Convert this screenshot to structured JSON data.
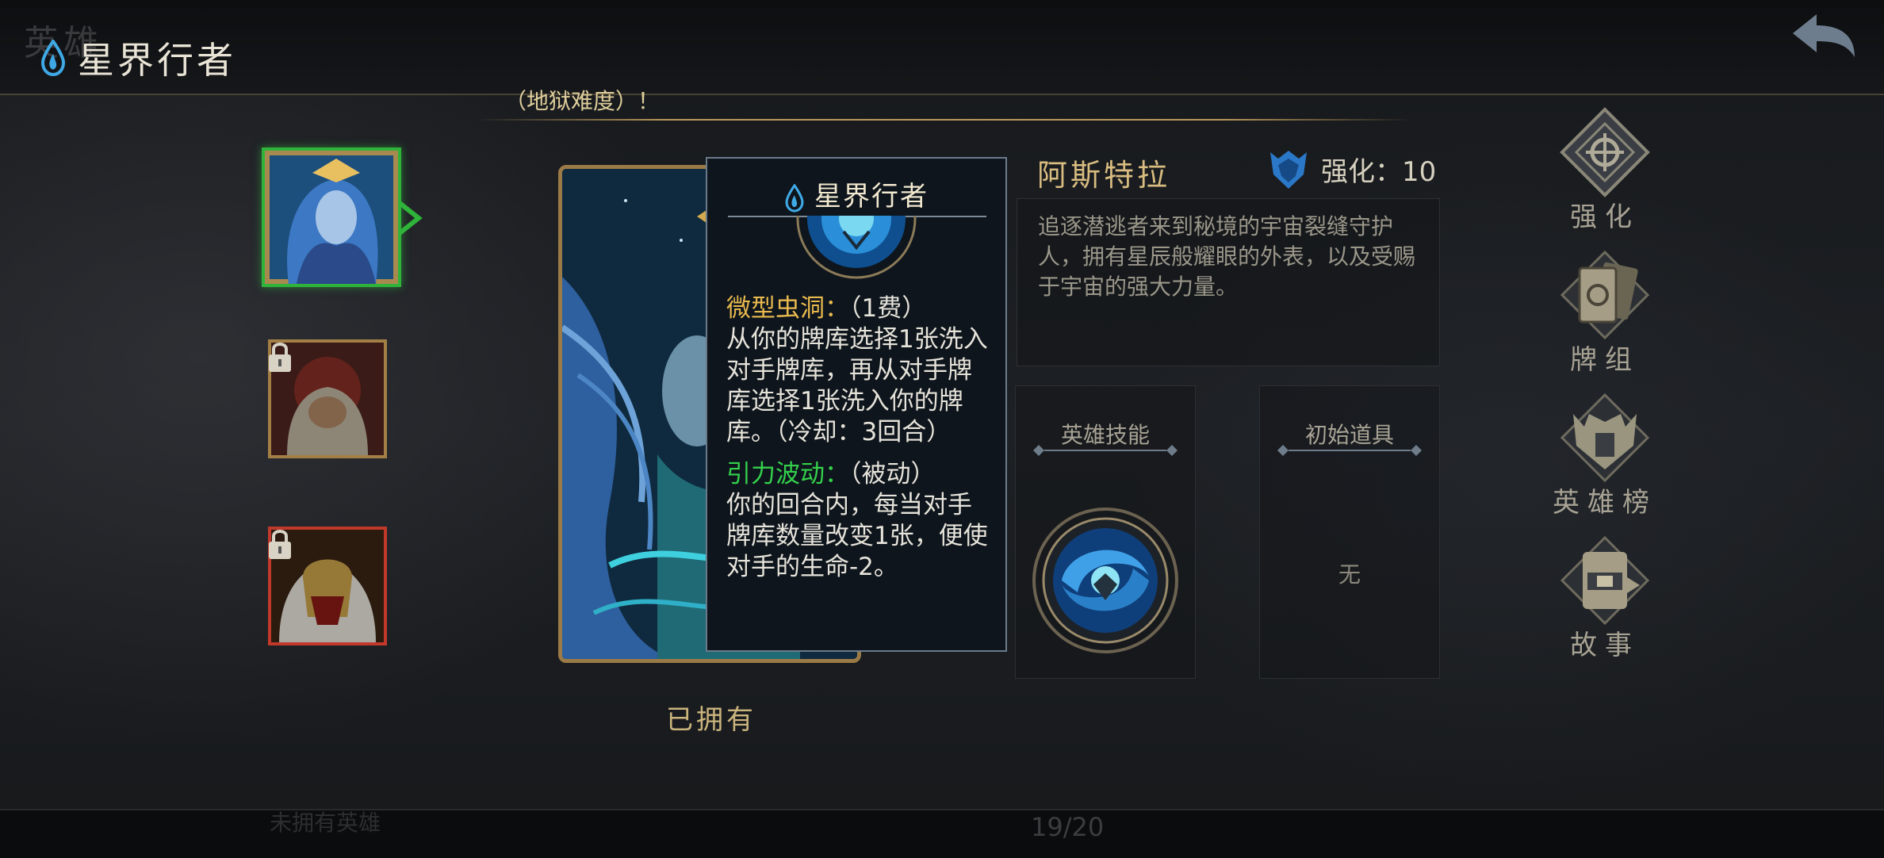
{
  "header": {
    "title": "星界行者",
    "hint": "（地狱难度）！",
    "ghost_text": "英雄"
  },
  "hero_list": [
    {
      "name": "astra-portrait",
      "selected": true,
      "locked": false,
      "border": "#2fb33a"
    },
    {
      "name": "hero-2-portrait",
      "selected": false,
      "locked": true,
      "border": "#a37f45"
    },
    {
      "name": "hero-3-portrait",
      "selected": false,
      "locked": true,
      "border": "#c0392b"
    }
  ],
  "card": {
    "status": "已拥有"
  },
  "tooltip": {
    "title": "星界行者",
    "skill1_name": "微型虫洞：",
    "skill1_cost": "（1费）",
    "skill1_desc": "从你的牌库选择1张洗入对手牌库，再从对手牌库选择1张洗入你的牌库。（冷却：3回合）",
    "skill2_name": "引力波动：",
    "skill2_type": "（被动）",
    "skill2_desc": "你的回合内，每当对手牌库数量改变1张，便使对手的生命-2。"
  },
  "hero_info": {
    "name": "阿斯特拉",
    "enhance_label": "强化：10",
    "description": "追逐潜逃者来到秘境的宇宙裂缝守护人，拥有星辰般耀眼的外表，以及受赐于宇宙的强大力量。",
    "skill_panel_title": "英雄技能",
    "item_panel_title": "初始道具",
    "item_none": "无"
  },
  "side_menu": [
    {
      "label": "强化",
      "icon": "enhance-icon"
    },
    {
      "label": "牌组",
      "icon": "deck-icon"
    },
    {
      "label": "英雄榜",
      "icon": "hero-rank-icon"
    },
    {
      "label": "故事",
      "icon": "story-icon"
    }
  ],
  "footer": {
    "page": "19/20",
    "ghost_text": "未拥有英雄"
  },
  "colors": {
    "gold": "#b8975a",
    "selected_green": "#2fb33a",
    "skill_gold": "#e8b94e",
    "skill_green": "#34d04c"
  }
}
